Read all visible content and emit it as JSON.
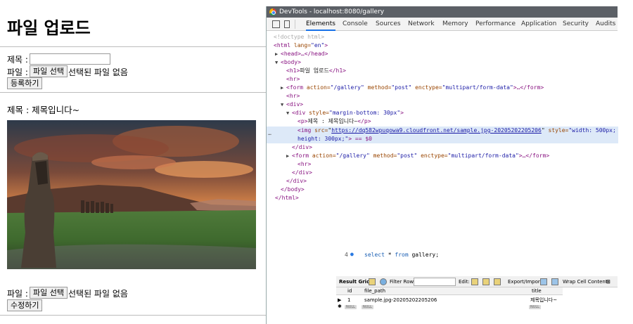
{
  "page": {
    "title": "파일 업로드",
    "upload_form": {
      "title_label": "제목 :",
      "file_label": "파일 :",
      "choose_file_button": "파일 선택",
      "no_file_text": "선택된 파일 없음",
      "submit_button": "등록하기"
    },
    "post": {
      "title_text": "제목 : 제목입니다~",
      "image_alt": "Moai statues landscape at sunset"
    },
    "edit_form": {
      "file_label": "파일 :",
      "choose_file_button": "파일 선택",
      "no_file_text": "선택된 파일 없음",
      "submit_button": "수정하기"
    }
  },
  "devtools": {
    "window_title": "DevTools - localhost:8080/gallery",
    "tabs": [
      "Elements",
      "Console",
      "Sources",
      "Network",
      "Memory",
      "Performance",
      "Application",
      "Security",
      "Audits"
    ],
    "active_tab": "Elements",
    "code": {
      "doctype": "<!doctype html>",
      "html_open": "<html",
      "html_lang_attr": "lang=",
      "html_lang_val": "\"en\"",
      "html_close_bracket": ">",
      "head": "<head>…</head>",
      "body_open": "<body>",
      "h1_open": "<h1>",
      "h1_text": "파일 업로드",
      "h1_close": "</h1>",
      "hr": "<hr>",
      "form_open": "<form",
      "action_attr": "action=",
      "action_val": "\"/gallery\"",
      "method_attr": "method=",
      "method_val": "\"post\"",
      "enctype_attr": "enctype=",
      "enctype_val": "\"multipart/form-data\"",
      "form_rest": ">…</form>",
      "div_open": "<div>",
      "div_style_open": "<div",
      "style_attr": "style=",
      "div_style_val": "\"margin-bottom: 30px\"",
      "p_open": "<p>",
      "p_text": "제목 : 제목입니다~",
      "p_close": "</p>",
      "img_open": "<img",
      "src_attr": "src=",
      "img_src": "https://dq582wpuqowa9.cloudfront.net/sample.jpg-20205202205206",
      "img_style_val_1": "\"width: 500px;",
      "img_style_val_2": "height: 300px;\"",
      "img_tail": "> == $0",
      "div_close": "</div>",
      "body_close": "</body>",
      "html_close": "</html>"
    }
  },
  "query": {
    "line_number": "4",
    "keyword_select": "select",
    "star": "*",
    "keyword_from": "from",
    "table": "gallery;"
  },
  "result_grid": {
    "label": "Result Grid",
    "filter_label": "Filter Rows:",
    "edit_label": "Edit:",
    "export_label": "Export/Import:",
    "wrap_label": "Wrap Cell Content:",
    "columns": [
      "id",
      "file_path",
      "title"
    ],
    "rows": [
      {
        "id": "1",
        "file_path": "sample.jpg-20205202205206",
        "title": "제목입니다~"
      }
    ],
    "null_label": "NULL"
  }
}
